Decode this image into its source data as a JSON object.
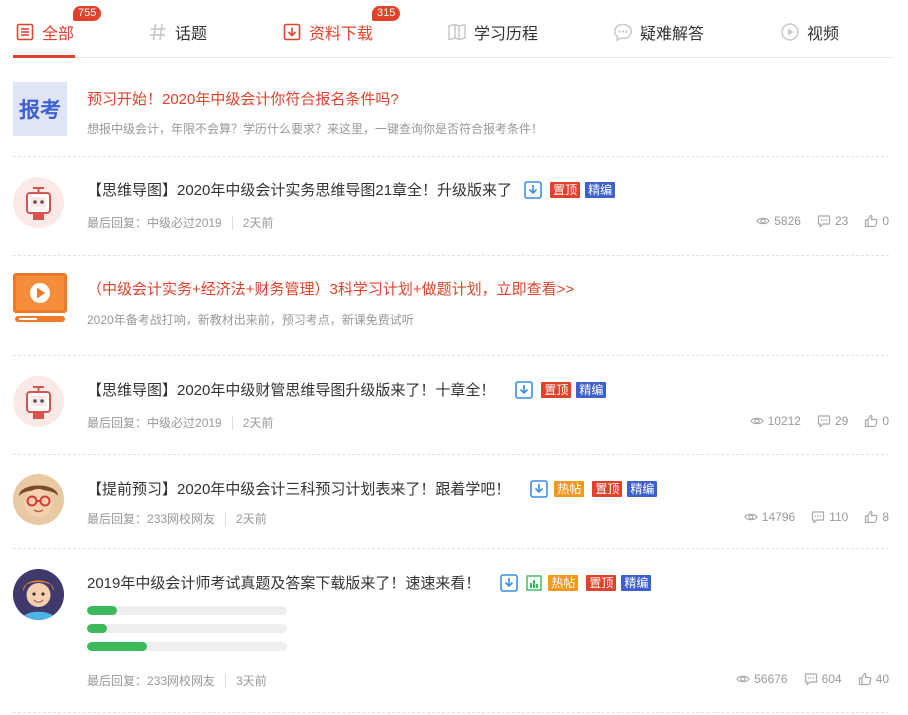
{
  "tabs": [
    {
      "label": "全部",
      "badge": "755",
      "icon": "list-icon"
    },
    {
      "label": "话题",
      "badge": "",
      "icon": "hash-icon"
    },
    {
      "label": "资料下载",
      "badge": "315",
      "icon": "download-icon"
    },
    {
      "label": "学习历程",
      "badge": "",
      "icon": "book-icon"
    },
    {
      "label": "疑难解答",
      "badge": "",
      "icon": "chat-icon"
    },
    {
      "label": "视频",
      "badge": "",
      "icon": "play-icon"
    }
  ],
  "colors": {
    "accent": "#e2422c",
    "hot": "#f39a1b",
    "best": "#3e5fce",
    "progress": "#3cb95a"
  },
  "tags": {
    "top": "置顶",
    "hot": "热帖",
    "best": "精编"
  },
  "meta_prefix": "最后回复：",
  "ad1": {
    "logo_text": "报考",
    "title": "预习开始！2020年中级会计你符合报名条件吗?",
    "desc": "想报中级会计，年限不会算？学历什么要求？来这里，一键查询你是否符合报考条件！"
  },
  "post1": {
    "title": "【思维导图】2020年中级会计实务思维导图21章全！升级版来了",
    "last_user": "中级必过2019",
    "time": "2天前",
    "views": "5826",
    "replies": "23",
    "likes": "0"
  },
  "ad2": {
    "title": "（中级会计实务+经济法+财务管理）3科学习计划+做题计划，立即查看>>",
    "desc": "2020年备考战打响，新教材出来前，预习考点，新课免费试听"
  },
  "post2": {
    "title": "【思维导图】2020年中级财管思维导图升级版来了！十章全！",
    "last_user": "中级必过2019",
    "time": "2天前",
    "views": "10212",
    "replies": "29",
    "likes": "0"
  },
  "post3": {
    "title": "【提前预习】2020年中级会计三科预习计划表来了！跟着学吧！",
    "last_user": "233网校网友",
    "time": "2天前",
    "views": "14796",
    "replies": "110",
    "likes": "8"
  },
  "post4": {
    "title": "2019年中级会计师考试真题及答案下载版来了！速速来看！",
    "last_user": "233网校网友",
    "time": "3天前",
    "views": "56676",
    "replies": "604",
    "likes": "40",
    "progress": [
      0.15,
      0.1,
      0.3
    ]
  }
}
